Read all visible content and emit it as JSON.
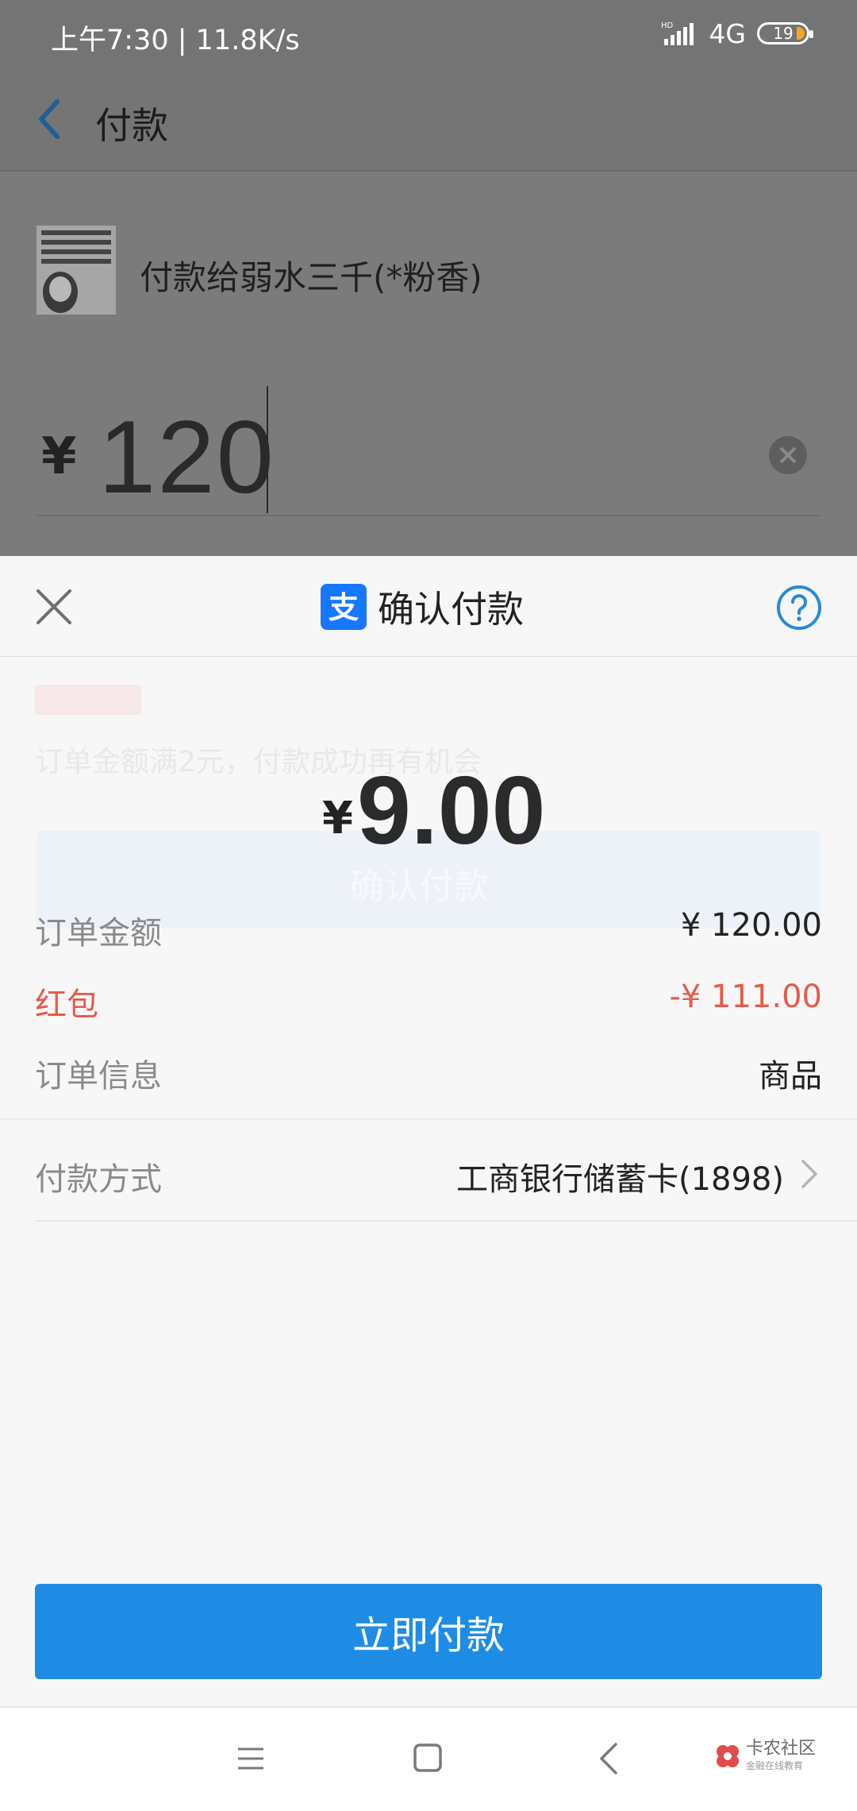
{
  "status_bar": {
    "time": "上午7:30",
    "speed": "11.8K/s",
    "network": "4G",
    "battery": "19"
  },
  "header": {
    "title": "付款"
  },
  "payment_page": {
    "payee": "付款给弱水三千(*粉香)",
    "avatar_text": "秋名山上行人稀 常有车手较高低 如今车道依旧在 不见当年老司机",
    "currency": "¥",
    "amount_input": "120"
  },
  "sheet": {
    "title": "确认付款",
    "logo_char": "支",
    "faded_text": "订单金额满2元，付款成功再有机会",
    "faded_button": "确认付款",
    "currency": "¥",
    "amount": "9.00",
    "rows": [
      {
        "label": "订单金额",
        "value": "¥ 120.00"
      },
      {
        "label": "红包",
        "value": "-¥ 111.00"
      },
      {
        "label": "订单信息",
        "value": "商品"
      }
    ],
    "payment_method_label": "付款方式",
    "payment_method_value": "工商银行储蓄卡(1898)",
    "pay_button": "立即付款"
  },
  "watermark": {
    "name": "卡农社区",
    "sub": "金融在线教育"
  },
  "colors": {
    "accent": "#1e8ce4",
    "discount_red": "#e65a4b",
    "alipay_blue": "#1677ff"
  }
}
